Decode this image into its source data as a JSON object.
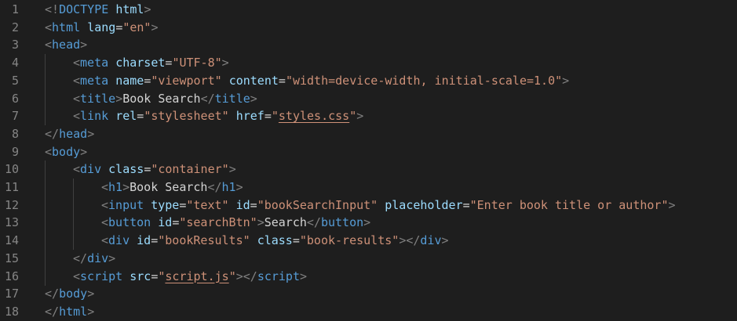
{
  "colors": {
    "background": "#1e1e1e",
    "line_number": "#858585",
    "tag": "#569cd6",
    "attribute": "#9cdcfe",
    "string": "#ce9178",
    "punctuation": "#808080",
    "text": "#d4d4d4"
  },
  "lines": [
    {
      "n": "1",
      "indent": 0,
      "tokens": [
        [
          "pun",
          "<!"
        ],
        [
          "tag",
          "DOCTYPE"
        ],
        [
          "txt",
          " "
        ],
        [
          "attr",
          "html"
        ],
        [
          "pun",
          ">"
        ]
      ]
    },
    {
      "n": "2",
      "indent": 0,
      "tokens": [
        [
          "pun",
          "<"
        ],
        [
          "tag",
          "html"
        ],
        [
          "txt",
          " "
        ],
        [
          "attr",
          "lang"
        ],
        [
          "txt",
          "="
        ],
        [
          "str",
          "\"en\""
        ],
        [
          "pun",
          ">"
        ]
      ]
    },
    {
      "n": "3",
      "indent": 0,
      "tokens": [
        [
          "pun",
          "<"
        ],
        [
          "tag",
          "head"
        ],
        [
          "pun",
          ">"
        ]
      ]
    },
    {
      "n": "4",
      "indent": 1,
      "tokens": [
        [
          "pun",
          "<"
        ],
        [
          "tag",
          "meta"
        ],
        [
          "txt",
          " "
        ],
        [
          "attr",
          "charset"
        ],
        [
          "txt",
          "="
        ],
        [
          "str",
          "\"UTF-8\""
        ],
        [
          "pun",
          ">"
        ]
      ]
    },
    {
      "n": "5",
      "indent": 1,
      "tokens": [
        [
          "pun",
          "<"
        ],
        [
          "tag",
          "meta"
        ],
        [
          "txt",
          " "
        ],
        [
          "attr",
          "name"
        ],
        [
          "txt",
          "="
        ],
        [
          "str",
          "\"viewport\""
        ],
        [
          "txt",
          " "
        ],
        [
          "attr",
          "content"
        ],
        [
          "txt",
          "="
        ],
        [
          "str",
          "\"width=device-width, initial-scale=1.0\""
        ],
        [
          "pun",
          ">"
        ]
      ]
    },
    {
      "n": "6",
      "indent": 1,
      "tokens": [
        [
          "pun",
          "<"
        ],
        [
          "tag",
          "title"
        ],
        [
          "pun",
          ">"
        ],
        [
          "txt",
          "Book Search"
        ],
        [
          "pun",
          "</"
        ],
        [
          "tag",
          "title"
        ],
        [
          "pun",
          ">"
        ]
      ]
    },
    {
      "n": "7",
      "indent": 1,
      "tokens": [
        [
          "pun",
          "<"
        ],
        [
          "tag",
          "link"
        ],
        [
          "txt",
          " "
        ],
        [
          "attr",
          "rel"
        ],
        [
          "txt",
          "="
        ],
        [
          "str",
          "\"stylesheet\""
        ],
        [
          "txt",
          " "
        ],
        [
          "attr",
          "href"
        ],
        [
          "txt",
          "="
        ],
        [
          "str",
          "\""
        ],
        [
          "strln",
          "styles.css"
        ],
        [
          "str",
          "\""
        ],
        [
          "pun",
          ">"
        ]
      ]
    },
    {
      "n": "8",
      "indent": 0,
      "tokens": [
        [
          "pun",
          "</"
        ],
        [
          "tag",
          "head"
        ],
        [
          "pun",
          ">"
        ]
      ]
    },
    {
      "n": "9",
      "indent": 0,
      "tokens": [
        [
          "pun",
          "<"
        ],
        [
          "tag",
          "body"
        ],
        [
          "pun",
          ">"
        ]
      ]
    },
    {
      "n": "10",
      "indent": 1,
      "tokens": [
        [
          "pun",
          "<"
        ],
        [
          "tag",
          "div"
        ],
        [
          "txt",
          " "
        ],
        [
          "attr",
          "class"
        ],
        [
          "txt",
          "="
        ],
        [
          "str",
          "\"container\""
        ],
        [
          "pun",
          ">"
        ]
      ]
    },
    {
      "n": "11",
      "indent": 2,
      "tokens": [
        [
          "pun",
          "<"
        ],
        [
          "tag",
          "h1"
        ],
        [
          "pun",
          ">"
        ],
        [
          "txt",
          "Book Search"
        ],
        [
          "pun",
          "</"
        ],
        [
          "tag",
          "h1"
        ],
        [
          "pun",
          ">"
        ]
      ]
    },
    {
      "n": "12",
      "indent": 2,
      "tokens": [
        [
          "pun",
          "<"
        ],
        [
          "tag",
          "input"
        ],
        [
          "txt",
          " "
        ],
        [
          "attr",
          "type"
        ],
        [
          "txt",
          "="
        ],
        [
          "str",
          "\"text\""
        ],
        [
          "txt",
          " "
        ],
        [
          "attr",
          "id"
        ],
        [
          "txt",
          "="
        ],
        [
          "str",
          "\"bookSearchInput\""
        ],
        [
          "txt",
          " "
        ],
        [
          "attr",
          "placeholder"
        ],
        [
          "txt",
          "="
        ],
        [
          "str",
          "\"Enter book title or author\""
        ],
        [
          "pun",
          ">"
        ]
      ]
    },
    {
      "n": "13",
      "indent": 2,
      "tokens": [
        [
          "pun",
          "<"
        ],
        [
          "tag",
          "button"
        ],
        [
          "txt",
          " "
        ],
        [
          "attr",
          "id"
        ],
        [
          "txt",
          "="
        ],
        [
          "str",
          "\"searchBtn\""
        ],
        [
          "pun",
          ">"
        ],
        [
          "txt",
          "Search"
        ],
        [
          "pun",
          "</"
        ],
        [
          "tag",
          "button"
        ],
        [
          "pun",
          ">"
        ]
      ]
    },
    {
      "n": "14",
      "indent": 2,
      "tokens": [
        [
          "pun",
          "<"
        ],
        [
          "tag",
          "div"
        ],
        [
          "txt",
          " "
        ],
        [
          "attr",
          "id"
        ],
        [
          "txt",
          "="
        ],
        [
          "str",
          "\"bookResults\""
        ],
        [
          "txt",
          " "
        ],
        [
          "attr",
          "class"
        ],
        [
          "txt",
          "="
        ],
        [
          "str",
          "\"book-results\""
        ],
        [
          "pun",
          "></"
        ],
        [
          "tag",
          "div"
        ],
        [
          "pun",
          ">"
        ]
      ]
    },
    {
      "n": "15",
      "indent": 1,
      "tokens": [
        [
          "pun",
          "</"
        ],
        [
          "tag",
          "div"
        ],
        [
          "pun",
          ">"
        ]
      ]
    },
    {
      "n": "16",
      "indent": 1,
      "tokens": [
        [
          "pun",
          "<"
        ],
        [
          "tag",
          "script"
        ],
        [
          "txt",
          " "
        ],
        [
          "attr",
          "src"
        ],
        [
          "txt",
          "="
        ],
        [
          "str",
          "\""
        ],
        [
          "strln",
          "script.js"
        ],
        [
          "str",
          "\""
        ],
        [
          "pun",
          "></"
        ],
        [
          "tag",
          "script"
        ],
        [
          "pun",
          ">"
        ]
      ]
    },
    {
      "n": "17",
      "indent": 0,
      "tokens": [
        [
          "pun",
          "</"
        ],
        [
          "tag",
          "body"
        ],
        [
          "pun",
          ">"
        ]
      ]
    },
    {
      "n": "18",
      "indent": 0,
      "tokens": [
        [
          "pun",
          "</"
        ],
        [
          "tag",
          "html"
        ],
        [
          "pun",
          ">"
        ]
      ]
    }
  ]
}
